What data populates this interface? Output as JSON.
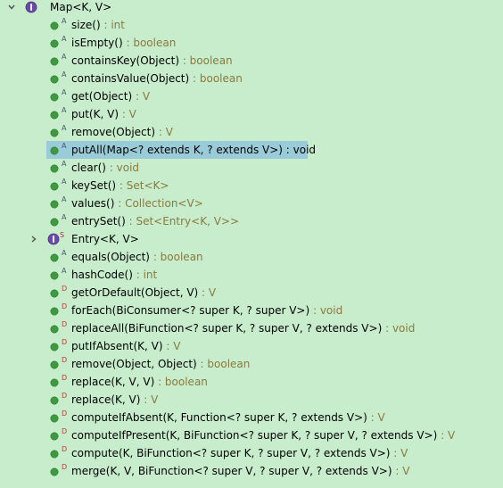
{
  "colors": {
    "background": "#c7edcc",
    "selection": "#99ccd8",
    "type_text": "#8a7a3e",
    "method_green": "#3f9a3f",
    "interface_purple": "#6a4aa8",
    "abstract_overlay": "#4a5a6a",
    "default_overlay": "#c0392b",
    "static_overlay": "#b0302a"
  },
  "root": {
    "name": "Map<K, V>",
    "expanded": true,
    "icon": "interface-icon"
  },
  "members": [
    {
      "kind": "method",
      "overlay": "A",
      "name": "size()",
      "type": " : int"
    },
    {
      "kind": "method",
      "overlay": "A",
      "name": "isEmpty()",
      "type": " : boolean"
    },
    {
      "kind": "method",
      "overlay": "A",
      "name": "containsKey(Object)",
      "type": " : boolean"
    },
    {
      "kind": "method",
      "overlay": "A",
      "name": "containsValue(Object)",
      "type": " : boolean"
    },
    {
      "kind": "method",
      "overlay": "A",
      "name": "get(Object)",
      "type": " : V"
    },
    {
      "kind": "method",
      "overlay": "A",
      "name": "put(K, V)",
      "type": " : V"
    },
    {
      "kind": "method",
      "overlay": "A",
      "name": "remove(Object)",
      "type": " : V"
    },
    {
      "kind": "method",
      "overlay": "A",
      "name": "putAll(Map<? extends K, ? extends V>) : void",
      "type": "",
      "selected": true
    },
    {
      "kind": "method",
      "overlay": "A",
      "name": "clear()",
      "type": " : void"
    },
    {
      "kind": "method",
      "overlay": "A",
      "name": "keySet()",
      "type": " : Set<K>"
    },
    {
      "kind": "method",
      "overlay": "A",
      "name": "values()",
      "type": " : Collection<V>"
    },
    {
      "kind": "method",
      "overlay": "A",
      "name": "entrySet()",
      "type": " : Set<Entry<K, V>>"
    },
    {
      "kind": "interface",
      "overlay": "S",
      "name": "Entry<K, V>",
      "type": "",
      "collapsed": true
    },
    {
      "kind": "method",
      "overlay": "A",
      "name": "equals(Object)",
      "type": " : boolean"
    },
    {
      "kind": "method",
      "overlay": "A",
      "name": "hashCode()",
      "type": " : int"
    },
    {
      "kind": "method",
      "overlay": "D",
      "name": "getOrDefault(Object, V)",
      "type": " : V"
    },
    {
      "kind": "method",
      "overlay": "D",
      "name": "forEach(BiConsumer<? super K, ? super V>)",
      "type": " : void"
    },
    {
      "kind": "method",
      "overlay": "D",
      "name": "replaceAll(BiFunction<? super K, ? super V, ? extends V>)",
      "type": " : void"
    },
    {
      "kind": "method",
      "overlay": "D",
      "name": "putIfAbsent(K, V)",
      "type": " : V"
    },
    {
      "kind": "method",
      "overlay": "D",
      "name": "remove(Object, Object)",
      "type": " : boolean"
    },
    {
      "kind": "method",
      "overlay": "D",
      "name": "replace(K, V, V)",
      "type": " : boolean"
    },
    {
      "kind": "method",
      "overlay": "D",
      "name": "replace(K, V)",
      "type": " : V"
    },
    {
      "kind": "method",
      "overlay": "D",
      "name": "computeIfAbsent(K, Function<? super K, ? extends V>)",
      "type": " : V"
    },
    {
      "kind": "method",
      "overlay": "D",
      "name": "computeIfPresent(K, BiFunction<? super K, ? super V, ? extends V>)",
      "type": " : V"
    },
    {
      "kind": "method",
      "overlay": "D",
      "name": "compute(K, BiFunction<? super K, ? super V, ? extends V>)",
      "type": " : V"
    },
    {
      "kind": "method",
      "overlay": "D",
      "name": "merge(K, V, BiFunction<? super V, ? super V, ? extends V>)",
      "type": " : V"
    }
  ]
}
